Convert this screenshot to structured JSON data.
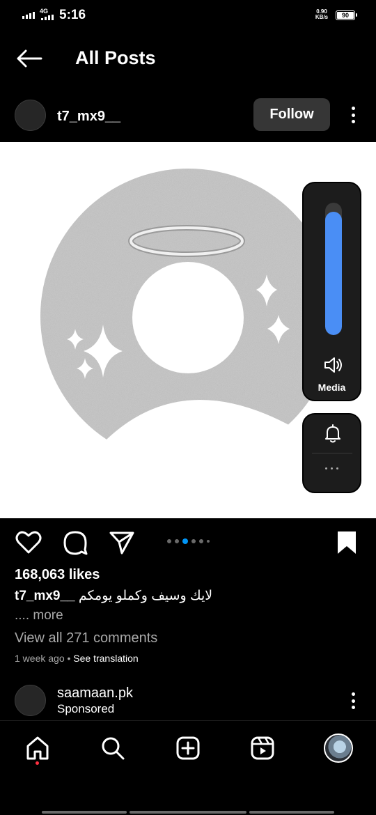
{
  "status_bar": {
    "network": "4G",
    "time": "5:16",
    "speed_value": "0.90",
    "speed_unit": "KB/s",
    "battery": "90"
  },
  "nav": {
    "title": "All Posts",
    "back_icon": "arrow-left-icon"
  },
  "post": {
    "username": "t7_mx9__",
    "follow_label": "Follow",
    "likes": "168,063 likes",
    "caption_user": "t7_mx9__",
    "caption_text": "لايك وسيف وكملو يومكم",
    "more_label": ".... more",
    "comments_label": "View all 271 comments",
    "time_ago": "1 week ago",
    "separator": " • ",
    "translate_label": "See translation",
    "carousel": {
      "count": 6,
      "active_index": 2
    },
    "image": {
      "background": "#ffffff",
      "shape_color": "#c4c4c4",
      "halo_color": "#e8e8e8"
    }
  },
  "volume_overlay": {
    "level": 0.93,
    "label": "Media",
    "fill_color": "#4a8ef5"
  },
  "next_post": {
    "username": "saamaan.pk",
    "sponsored_label": "Sponsored"
  },
  "bottom_nav": {
    "items": [
      "home-icon",
      "search-icon",
      "create-icon",
      "reels-icon",
      "profile-avatar"
    ],
    "active": "home-icon",
    "notification_dot_color": "#ff3040"
  }
}
